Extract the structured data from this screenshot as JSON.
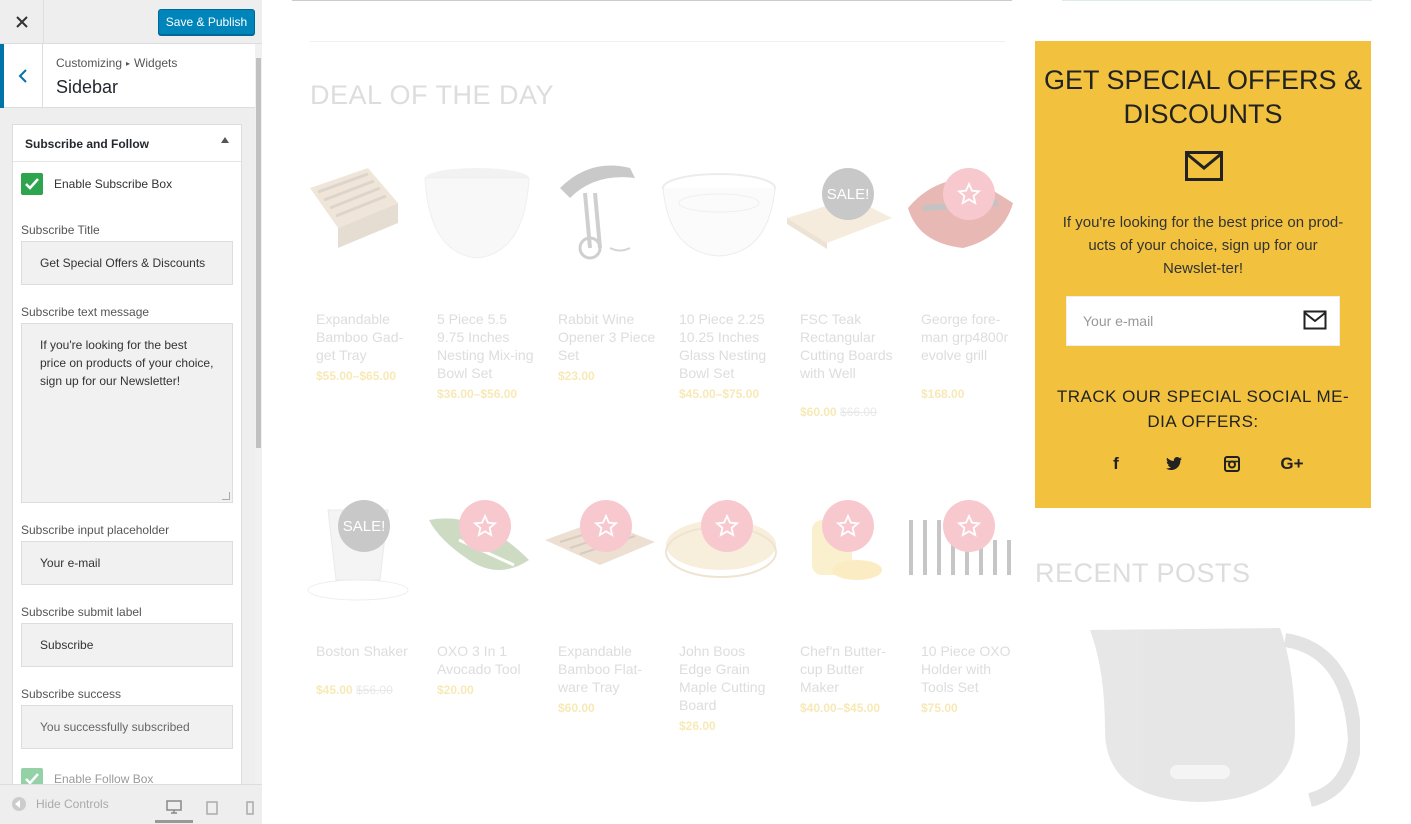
{
  "customizer": {
    "close_icon": "close-icon",
    "save_label": "Save & Publish",
    "breadcrumb": [
      "Customizing",
      "Widgets"
    ],
    "section_title": "Sidebar",
    "widget": {
      "title": "Subscribe and Follow",
      "enable_subscribe_label": "Enable Subscribe Box",
      "fields": {
        "title_label": "Subscribe Title",
        "title_value": "Get Special Offers & Discounts",
        "message_label": "Subscribe text message",
        "message_value": "If you're looking for the best price on products of your choice, sign up for our Newsletter!",
        "placeholder_label": "Subscribe input placeholder",
        "placeholder_value": "Your e-mail",
        "submit_label": "Subscribe submit label",
        "submit_value": "Subscribe",
        "success_label": "Subscribe success",
        "success_value": "You successfully subscribed"
      },
      "enable_follow_label": "Enable Follow Box"
    },
    "footer": {
      "hide_controls": "Hide Controls"
    }
  },
  "preview": {
    "deal_title": "DEAL OF THE DAY",
    "products_row1": [
      {
        "name": "Expandable Bamboo Gad-get Tray",
        "price": "$55.00–$65.00",
        "old_price": "",
        "badge": ""
      },
      {
        "name": "5 Piece 5.5 9.75 Inches Nesting Mix-ing Bowl Set",
        "price": "$36.00–$56.00",
        "old_price": "",
        "badge": ""
      },
      {
        "name": "Rabbit Wine Opener 3 Piece Set",
        "price": "$23.00",
        "old_price": "",
        "badge": ""
      },
      {
        "name": "10 Piece 2.25 10.25 Inches Glass Nesting Bowl Set",
        "price": "$45.00–$75.00",
        "old_price": "",
        "badge": ""
      },
      {
        "name": "FSC Teak Rectangular Cutting Boards with Well",
        "price": "$60.00",
        "old_price": "$66.00",
        "badge": "SALE!"
      },
      {
        "name": "George fore-man grp4800r evolve grill",
        "price": "$168.00",
        "old_price": "",
        "badge": "star"
      }
    ],
    "products_row2": [
      {
        "name": "Boston Shaker",
        "price": "$45.00",
        "old_price": "$56.00",
        "badge": "SALE!"
      },
      {
        "name": "OXO 3 In 1 Avocado Tool",
        "price": "$20.00",
        "old_price": "",
        "badge": "star"
      },
      {
        "name": "Expandable Bamboo Flat-ware Tray",
        "price": "$60.00",
        "old_price": "",
        "badge": "star"
      },
      {
        "name": "John Boos Edge Grain Maple Cutting Board",
        "price": "$26.00",
        "old_price": "",
        "badge": "star"
      },
      {
        "name": "Chef'n Butter-cup Butter Maker",
        "price": "$40.00–$45.00",
        "old_price": "",
        "badge": "star"
      },
      {
        "name": "10 Piece OXO Holder with Tools Set",
        "price": "$75.00",
        "old_price": "",
        "badge": "star"
      }
    ],
    "subscribe": {
      "title": "GET SPECIAL OFFERS & DISCOUNTS",
      "text": "If you're looking for the best price on prod-ucts of your choice, sign up for our Newslet-ter!",
      "placeholder": "Your e-mail",
      "track_title": "TRACK OUR SPECIAL SOCIAL ME-DIA OFFERS:",
      "socials": [
        "f",
        "twitter-icon",
        "instagram-icon",
        "G+"
      ],
      "bg_color": "#f2c23f"
    },
    "recent_title": "RECENT POSTS"
  },
  "colors": {
    "accent": "#0085ba",
    "check": "#2ea44f",
    "sale": "#c8c8c8",
    "star_badge": "#f8c8cf"
  }
}
